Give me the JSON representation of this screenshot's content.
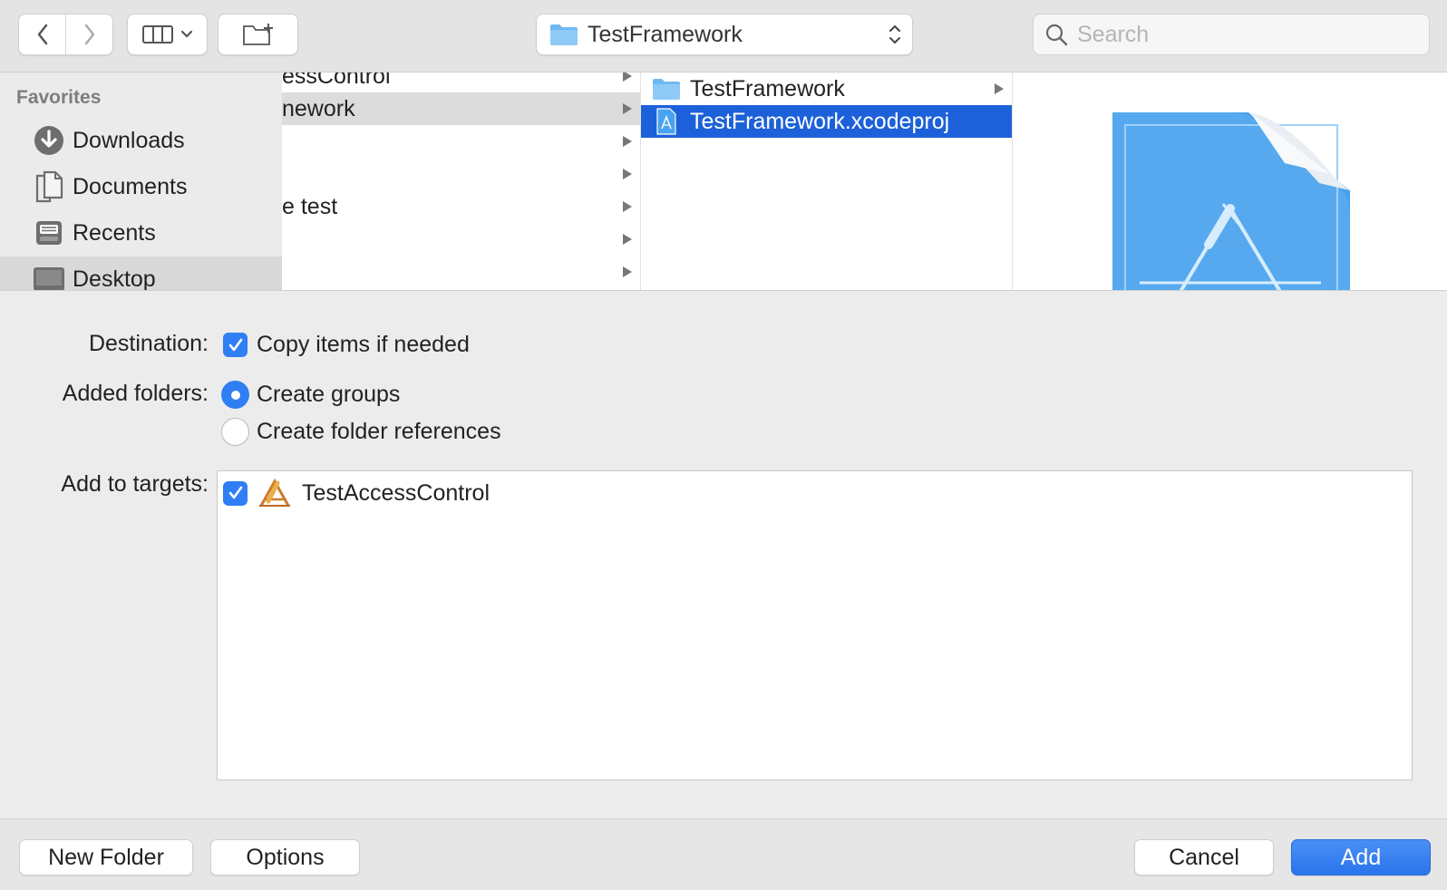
{
  "toolbar": {
    "back_icon": "chevron-left-icon",
    "forward_icon": "chevron-right-icon",
    "view_icon": "column-view-icon",
    "new_folder_icon": "new-folder-icon",
    "path_popup_label": "TestFramework",
    "search_placeholder": "Search"
  },
  "sidebar": {
    "section_title": "Favorites",
    "items": [
      {
        "label": "Downloads",
        "icon": "downloads-icon"
      },
      {
        "label": "Documents",
        "icon": "documents-icon"
      },
      {
        "label": "Recents",
        "icon": "recents-icon"
      },
      {
        "label": "Desktop",
        "icon": "desktop-icon",
        "selected": true
      }
    ]
  },
  "column1": {
    "rows": [
      {
        "label": "essControl",
        "has_children": true
      },
      {
        "label": "nework",
        "has_children": true,
        "selected": true
      },
      {
        "label": "",
        "has_children": true
      },
      {
        "label": "",
        "has_children": true
      },
      {
        "label": "e test",
        "has_children": true
      },
      {
        "label": "",
        "has_children": true
      },
      {
        "label": "",
        "has_children": true
      }
    ]
  },
  "column2": {
    "rows": [
      {
        "label": "TestFramework",
        "icon": "folder-icon",
        "has_children": true
      },
      {
        "label": "TestFramework.xcodeproj",
        "icon": "xcodeproj-icon",
        "selected": true
      }
    ]
  },
  "preview": {
    "icon": "xcodeproj-large-icon"
  },
  "options": {
    "destination_label": "Destination:",
    "copy_items_label": "Copy items if needed",
    "copy_items_checked": true,
    "added_folders_label": "Added folders:",
    "create_groups_label": "Create groups",
    "create_folder_refs_label": "Create folder references",
    "selected_folder_option": "Create groups",
    "add_to_targets_label": "Add to targets:",
    "targets": [
      {
        "name": "TestAccessControl",
        "checked": true,
        "icon": "app-target-icon"
      }
    ]
  },
  "buttons": {
    "new_folder": "New Folder",
    "options": "Options",
    "cancel": "Cancel",
    "add": "Add"
  },
  "colors": {
    "accent": "#2f7ef3",
    "selection": "#1c61d9"
  }
}
